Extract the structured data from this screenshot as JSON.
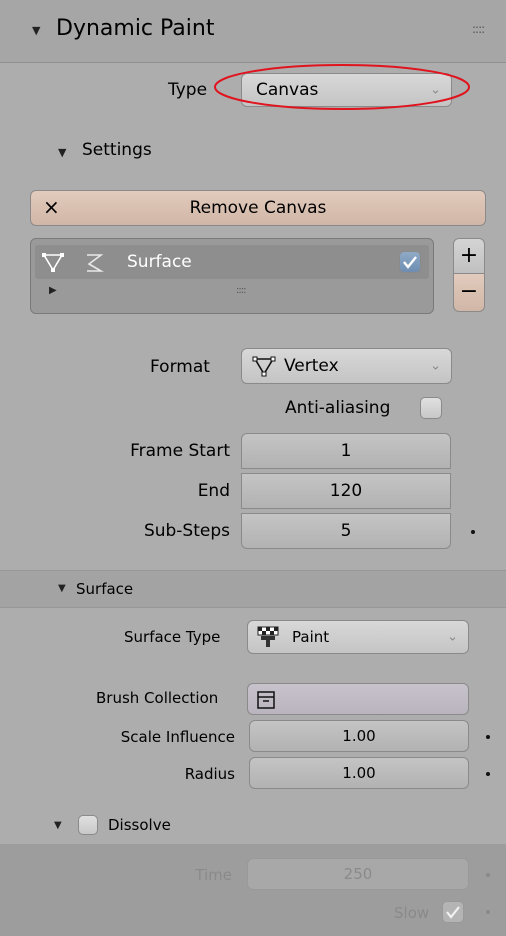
{
  "panel": {
    "title": "Dynamic Paint",
    "type_label": "Type",
    "type_value": "Canvas",
    "settings_label": "Settings",
    "remove_button": "Remove Canvas",
    "remove_icon": "×",
    "surface_list": {
      "item_label": "Surface",
      "item_enabled": true,
      "add": "+",
      "remove": "−"
    },
    "format_label": "Format",
    "format_value": "Vertex",
    "antialias_label": "Anti-aliasing",
    "frame_start_label": "Frame Start",
    "frame_start_value": "1",
    "end_label": "End",
    "end_value": "120",
    "substeps_label": "Sub-Steps",
    "substeps_value": "5"
  },
  "surface": {
    "header": "Surface",
    "type_label": "Surface Type",
    "type_value": "Paint",
    "brush_label": "Brush Collection",
    "scale_label": "Scale Influence",
    "scale_value": "1.00",
    "radius_label": "Radius",
    "radius_value": "1.00",
    "dissolve_label": "Dissolve",
    "time_label": "Time",
    "time_value": "250",
    "slow_label": "Slow"
  },
  "colors": {
    "highlight_ellipse": "#e0141e",
    "accent_remove": "#d9c0b0",
    "checkbox_blue": "#7a9cc0"
  },
  "icons": [
    "triangle-expand-icon",
    "drag-handle-icon",
    "close-icon",
    "mesh-vertex-icon",
    "paint-brush-icon",
    "checkmark-icon",
    "chevron-down-icon",
    "collection-icon",
    "checkerboard-paint-icon"
  ]
}
